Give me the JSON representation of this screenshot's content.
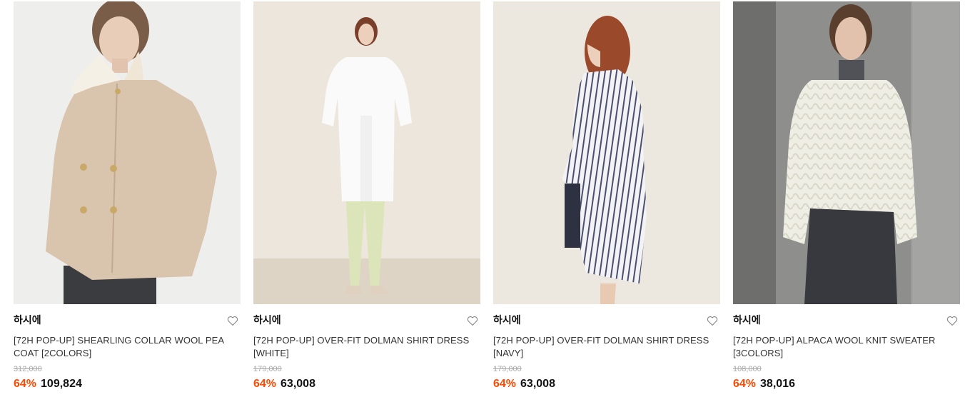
{
  "products": [
    {
      "brand": "하시에",
      "name": "[72H POP-UP] SHEARLING COLLAR WOOL PEA COAT [2COLORS]",
      "original_price": "312,000",
      "discount_rate": "64%",
      "sale_price": "109,824",
      "wishlist_icon": "heart-outline-icon",
      "image_desc": "model in beige pea coat with shearling collar"
    },
    {
      "brand": "하시에",
      "name": "[72H POP-UP] OVER-FIT DOLMAN SHIRT DRESS [WHITE]",
      "original_price": "179,000",
      "discount_rate": "64%",
      "sale_price": "63,008",
      "wishlist_icon": "heart-outline-icon",
      "image_desc": "model in white shirt dress with mint trousers"
    },
    {
      "brand": "하시에",
      "name": "[72H POP-UP] OVER-FIT DOLMAN SHIRT DRESS [NAVY]",
      "original_price": "179,000",
      "discount_rate": "64%",
      "sale_price": "63,008",
      "wishlist_icon": "heart-outline-icon",
      "image_desc": "model in navy striped shirt dress, back view"
    },
    {
      "brand": "하시에",
      "name": "[72H POP-UP] ALPACA WOOL KNIT SWEATER [3COLORS]",
      "original_price": "108,000",
      "discount_rate": "64%",
      "sale_price": "38,016",
      "wishlist_icon": "heart-outline-icon",
      "image_desc": "model in cream cable knit sweater over grey turtleneck"
    }
  ],
  "colors": {
    "discount": "#ff4800",
    "strike_price": "#aaaaaa",
    "text": "#333333"
  }
}
